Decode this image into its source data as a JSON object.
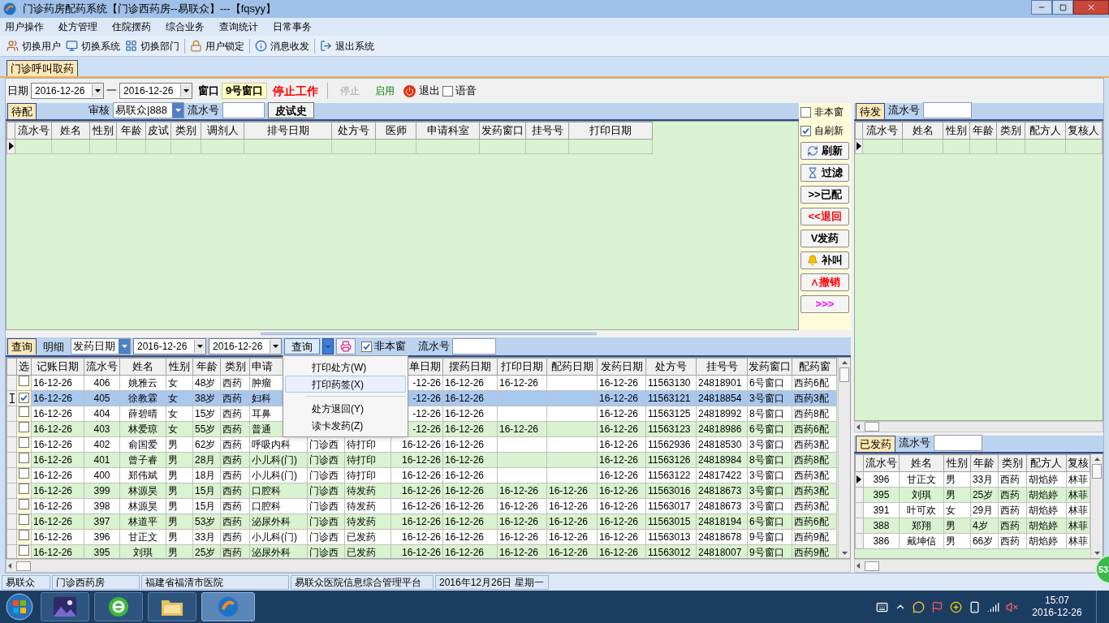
{
  "window": {
    "title": "门诊药房配药系统【门诊西药房--易联众】---【fqsyy】"
  },
  "menu_bar": [
    "用户操作",
    "处方管理",
    "住院摆药",
    "综合业务",
    "查询统计",
    "日常事务"
  ],
  "toolbar": [
    {
      "label": "切换用户",
      "kind": "users"
    },
    {
      "label": "切换系统",
      "kind": "system"
    },
    {
      "label": "切换部门",
      "kind": "dept"
    },
    {
      "label": "用户锁定",
      "kind": "lock"
    },
    {
      "label": "消息收发",
      "kind": "info"
    },
    {
      "label": "退出系统",
      "kind": "exit"
    }
  ],
  "tabs": [
    {
      "label": "门诊呼叫取药",
      "selected": true
    }
  ],
  "filter": {
    "date_label": "日期",
    "date_from": "2016-12-26",
    "separator": "一",
    "date_to": "2016-12-26",
    "window_label": "窗口",
    "window": "9号窗口",
    "work_status": "停止工作",
    "stop": {
      "label": "停止",
      "disabled": true
    },
    "start": {
      "label": "启用",
      "disabled": false
    },
    "exit": "退出",
    "voice": {
      "label": "语音",
      "checked": false
    }
  },
  "pending": {
    "tab": {
      "label": "待配",
      "selected": true
    },
    "review_label": "审核",
    "reviewer": "易联众|888",
    "serial_label": "流水号",
    "skin_test_button": "皮试史",
    "columns": [
      "流水号",
      "姓名",
      "性别",
      "年龄",
      "皮试",
      "类别",
      "调剂人",
      "排号日期",
      "处方号",
      "医师",
      "申请科室",
      "发药窗口",
      "挂号号",
      "打印日期"
    ]
  },
  "side": {
    "checkboxes": [
      {
        "label": "非本窗",
        "checked": false
      },
      {
        "label": "自刷新",
        "checked": true
      }
    ],
    "buttons": [
      {
        "label": "刷新",
        "kind": "refresh",
        "color": "#000000"
      },
      {
        "label": "过滤",
        "kind": "filter",
        "color": "#000000"
      },
      {
        "label": ">>已配",
        "kind": "plain",
        "color": "#000000"
      },
      {
        "label": "<<退回",
        "kind": "plain",
        "color": "#ff0000"
      },
      {
        "label": "V发药",
        "kind": "plain",
        "color": "#000000"
      },
      {
        "label": "补叫",
        "kind": "bell",
        "color": "#000000"
      },
      {
        "label": "∧撤销",
        "kind": "plain",
        "color": "#ff0000"
      },
      {
        "label": ">>>",
        "kind": "plain",
        "color": "#ff00ff"
      }
    ]
  },
  "query": {
    "tabs": [
      {
        "label": "查询",
        "selected": true
      },
      {
        "label": "明细",
        "selected": false
      }
    ],
    "date_field": "发药日期",
    "date_from": "2016-12-26",
    "date_to": "2016-12-26",
    "query_button": "查询",
    "other_window": {
      "label": "非本窗",
      "checked": true
    },
    "serial_label": "流水号",
    "select_column": "选",
    "columns": [
      "记账日期",
      "流水号",
      "姓名",
      "性别",
      "年龄",
      "类别",
      "申请",
      null,
      null,
      "单日期",
      "摆药日期",
      "打印日期",
      "配药日期",
      "发药日期",
      "处方号",
      "挂号号",
      "发药窗口",
      "配药窗"
    ],
    "rows": [
      {
        "checked": false,
        "selected": false,
        "cells": [
          "16-12-26",
          "406",
          "姚雅云",
          "女",
          "48岁",
          "西药",
          "肿瘤",
          null,
          null,
          "-12-26",
          "16-12-26",
          "16-12-26",
          null,
          "16-12-26",
          "11563130",
          "24818901",
          "6号窗口",
          "西药6配"
        ]
      },
      {
        "checked": true,
        "selected": true,
        "cells": [
          "16-12-26",
          "405",
          "徐教霖",
          "女",
          "38岁",
          "西药",
          "妇科",
          null,
          null,
          "-12-26",
          "16-12-26",
          null,
          null,
          "16-12-26",
          "11563121",
          "24818854",
          "3号窗口",
          "西药3配"
        ]
      },
      {
        "checked": false,
        "selected": false,
        "cells": [
          "16-12-26",
          "404",
          "薛碧晴",
          "女",
          "15岁",
          "西药",
          "耳鼻",
          null,
          null,
          "-12-26",
          "16-12-26",
          null,
          null,
          "16-12-26",
          "11563125",
          "24818992",
          "8号窗口",
          "西药8配"
        ]
      },
      {
        "checked": false,
        "selected": false,
        "cells": [
          "16-12-26",
          "403",
          "林爱琼",
          "女",
          "55岁",
          "西药",
          "普通",
          null,
          null,
          "-12-26",
          "16-12-26",
          "16-12-26",
          null,
          "16-12-26",
          "11563123",
          "24818986",
          "6号窗口",
          "西药6配"
        ]
      },
      {
        "checked": false,
        "selected": false,
        "cells": [
          "16-12-26",
          "402",
          "俞国爱",
          "男",
          "62岁",
          "西药",
          "呼吸内科",
          "门诊西",
          "待打印",
          "16-12-26",
          "16-12-26",
          null,
          null,
          "16-12-26",
          "11562936",
          "24818530",
          "3号窗口",
          "西药3配"
        ]
      },
      {
        "checked": false,
        "selected": false,
        "cells": [
          "16-12-26",
          "401",
          "曾子睿",
          "男",
          "28月",
          "西药",
          "小儿科(门)",
          "门诊西",
          "待打印",
          "16-12-26",
          "16-12-26",
          null,
          null,
          "16-12-26",
          "11563126",
          "24818984",
          "8号窗口",
          "西药8配"
        ]
      },
      {
        "checked": false,
        "selected": false,
        "cells": [
          "16-12-26",
          "400",
          "郑伟斌",
          "男",
          "18月",
          "西药",
          "小儿科(门)",
          "门诊西",
          "待打印",
          "16-12-26",
          "16-12-26",
          null,
          null,
          "16-12-26",
          "11563122",
          "24817422",
          "3号窗口",
          "西药3配"
        ]
      },
      {
        "checked": false,
        "selected": false,
        "cells": [
          "16-12-26",
          "399",
          "林源昊",
          "男",
          "15月",
          "西药",
          "口腔科",
          "门诊西",
          "待发药",
          "16-12-26",
          "16-12-26",
          "16-12-26",
          "16-12-26",
          "16-12-26",
          "11563016",
          "24818673",
          "3号窗口",
          "西药3配"
        ]
      },
      {
        "checked": false,
        "selected": false,
        "cells": [
          "16-12-26",
          "398",
          "林源昊",
          "男",
          "15月",
          "西药",
          "口腔科",
          "门诊西",
          "待发药",
          "16-12-26",
          "16-12-26",
          "16-12-26",
          "16-12-26",
          "16-12-26",
          "11563017",
          "24818673",
          "3号窗口",
          "西药3配"
        ]
      },
      {
        "checked": false,
        "selected": false,
        "cells": [
          "16-12-26",
          "397",
          "林道平",
          "男",
          "53岁",
          "西药",
          "泌尿外科",
          "门诊西",
          "待发药",
          "16-12-26",
          "16-12-26",
          "16-12-26",
          "16-12-26",
          "16-12-26",
          "11563015",
          "24818194",
          "6号窗口",
          "西药6配"
        ]
      },
      {
        "checked": false,
        "selected": false,
        "cells": [
          "16-12-26",
          "396",
          "甘正文",
          "男",
          "33月",
          "西药",
          "小儿科(门)",
          "门诊西",
          "已发药",
          "16-12-26",
          "16-12-26",
          "16-12-26",
          "16-12-26",
          "16-12-26",
          "11563013",
          "24818678",
          "9号窗口",
          "西药9配"
        ]
      },
      {
        "checked": false,
        "selected": false,
        "cells": [
          "16-12-26",
          "395",
          "刘琪",
          "男",
          "25岁",
          "西药",
          "泌尿外科",
          "门诊西",
          "已发药",
          "16-12-26",
          "16-12-26",
          "16-12-26",
          "16-12-26",
          "16-12-26",
          "11563012",
          "24818007",
          "9号窗口",
          "西药9配"
        ]
      }
    ],
    "menu": {
      "groups": [
        [
          {
            "label": "打印处方(W)",
            "highlighted": false
          },
          {
            "label": "打印药签(X)",
            "highlighted": true
          }
        ],
        [
          {
            "label": "处方退回(Y)",
            "highlighted": false
          },
          {
            "label": "读卡发药(Z)",
            "highlighted": false
          }
        ]
      ]
    }
  },
  "to_dispense": {
    "tab": {
      "label": "待发",
      "selected": true
    },
    "serial_label": "流水号",
    "columns": [
      "流水号",
      "姓名",
      "性别",
      "年龄",
      "类别",
      "配方人",
      "复核人"
    ]
  },
  "dispensed": {
    "tab": {
      "label": "已发药",
      "selected": true
    },
    "serial_label": "流水号",
    "columns": [
      "流水号",
      "姓名",
      "性别",
      "年龄",
      "类别",
      "配方人",
      "复核"
    ],
    "rows": [
      {
        "current": true,
        "cells": [
          "396",
          "甘正文",
          "男",
          "33月",
          "西药",
          "胡焰婷",
          "林菲"
        ]
      },
      {
        "current": false,
        "cells": [
          "395",
          "刘琪",
          "男",
          "25岁",
          "西药",
          "胡焰婷",
          "林菲"
        ]
      },
      {
        "current": false,
        "cells": [
          "391",
          "叶可欢",
          "女",
          "29月",
          "西药",
          "胡焰婷",
          "林菲"
        ]
      },
      {
        "current": false,
        "cells": [
          "388",
          "郑翔",
          "男",
          "4岁",
          "西药",
          "胡焰婷",
          "林菲"
        ]
      },
      {
        "current": false,
        "cells": [
          "386",
          "戴坤信",
          "男",
          "66岁",
          "西药",
          "胡焰婷",
          "林菲"
        ]
      }
    ]
  },
  "status_bar": [
    "易联众",
    "门诊西药房",
    "福建省福清市医院",
    "易联众医院信息综合管理平台",
    "2016年12月26日 星期一"
  ],
  "badge": "53",
  "taskbar": {
    "time": "15:07",
    "date": "2016-12-26"
  }
}
